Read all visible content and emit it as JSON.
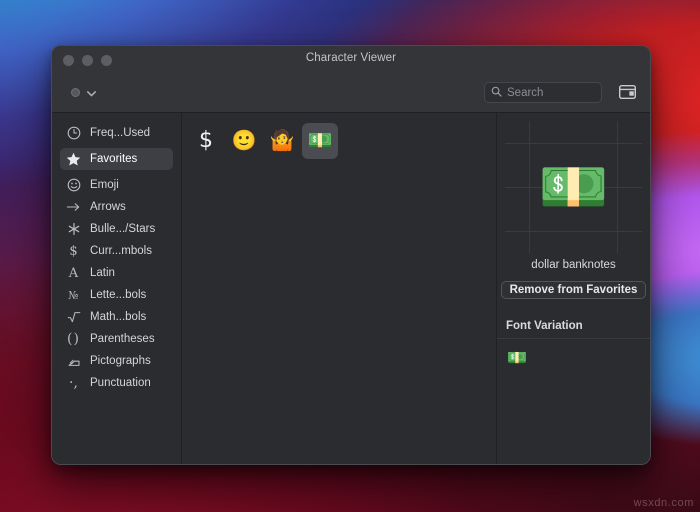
{
  "window": {
    "title": "Character Viewer",
    "traffic_lights": [
      "close",
      "minimize",
      "zoom"
    ]
  },
  "toolbar": {
    "category_popup_label": "",
    "search": {
      "value": "",
      "placeholder": "Search",
      "icon": "search-icon"
    },
    "panel_toggle_icon": "window-panel-icon"
  },
  "sidebar": {
    "items": [
      {
        "label": "Freq...Used",
        "icon": "clock-icon",
        "selected": false
      },
      {
        "label": "Favorites",
        "icon": "star-icon",
        "selected": true
      },
      {
        "label": "Emoji",
        "icon": "smiley-icon",
        "selected": false
      },
      {
        "label": "Arrows",
        "icon": "arrow-right-icon",
        "selected": false
      },
      {
        "label": "Bulle.../Stars",
        "icon": "asterisk-icon",
        "selected": false
      },
      {
        "label": "Curr...mbols",
        "icon": "dollar-icon",
        "selected": false
      },
      {
        "label": "Latin",
        "icon": "letter-a-icon",
        "selected": false
      },
      {
        "label": "Lette...bols",
        "icon": "numero-icon",
        "selected": false
      },
      {
        "label": "Math...bols",
        "icon": "square-root-icon",
        "selected": false
      },
      {
        "label": "Parentheses",
        "icon": "parentheses-icon",
        "selected": false
      },
      {
        "label": "Pictographs",
        "icon": "pictograph-icon",
        "selected": false
      },
      {
        "label": "Punctuation",
        "icon": "punctuation-icon",
        "selected": false
      }
    ]
  },
  "grid": {
    "characters": [
      {
        "glyph": "$",
        "name": "dollar-sign",
        "selected": false
      },
      {
        "glyph": "🙂",
        "name": "slightly-smiling-face",
        "selected": false
      },
      {
        "glyph": "🤷",
        "name": "person-shrugging",
        "selected": false
      },
      {
        "glyph": "💵",
        "name": "dollar-banknote",
        "selected": true
      }
    ]
  },
  "detail": {
    "preview_glyph": "💵",
    "character_name": "dollar banknotes",
    "favorite_button_label": "Remove from Favorites",
    "font_variation_title": "Font Variation",
    "font_variations": [
      {
        "glyph": "💵",
        "name": "dollar-banknote-variant"
      }
    ]
  },
  "watermark": "wsxdn.com",
  "colors": {
    "window_bg": "#2b2c30",
    "titlebar_bg": "#343539",
    "selection": "#3e3f44",
    "cell_selection": "#4b4c51",
    "text_primary": "#d4d5d9",
    "text_muted": "#8b8d93",
    "divider": "#202124"
  }
}
